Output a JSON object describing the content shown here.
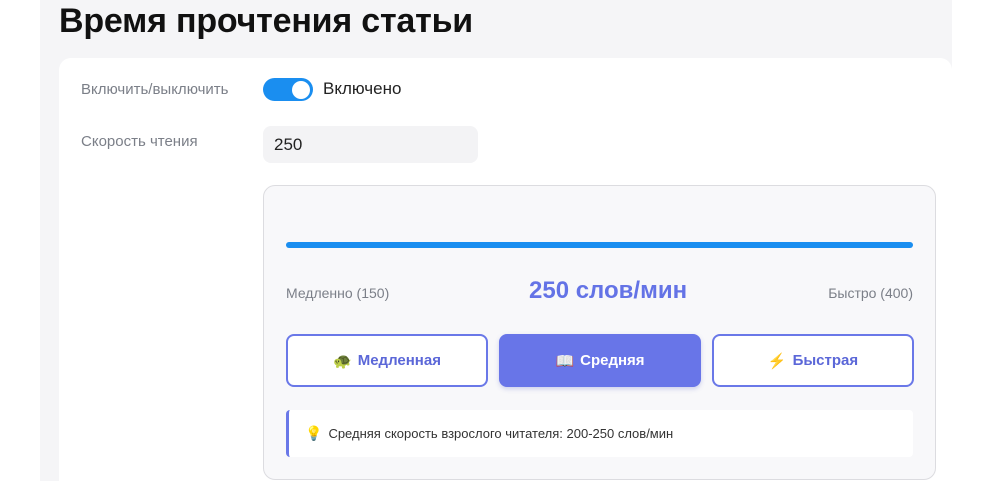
{
  "page": {
    "title": "Время прочтения статьи"
  },
  "toggle": {
    "label": "Включить/выключить",
    "state_text": "Включено",
    "on": true
  },
  "speed": {
    "label": "Скорость чтения",
    "value": "250"
  },
  "slider": {
    "min_label": "Медленно (150)",
    "max_label": "Быстро (400)",
    "value_label": "250 слов/мин",
    "fill_fraction": 1.0
  },
  "presets": [
    {
      "label": "Медленная",
      "icon": "turtle-icon",
      "glyph": "🐢",
      "active": false
    },
    {
      "label": "Средняя",
      "icon": "book-icon",
      "glyph": "📖",
      "active": true
    },
    {
      "label": "Быстрая",
      "icon": "lightning-icon",
      "glyph": "⚡",
      "active": false
    }
  ],
  "hint": {
    "icon": "lightbulb-icon",
    "glyph": "💡",
    "text": "Средняя скорость взрослого читателя: 200-250 слов/мин"
  },
  "colors": {
    "accent": "#1a8ef0",
    "primary": "#6875e8"
  }
}
